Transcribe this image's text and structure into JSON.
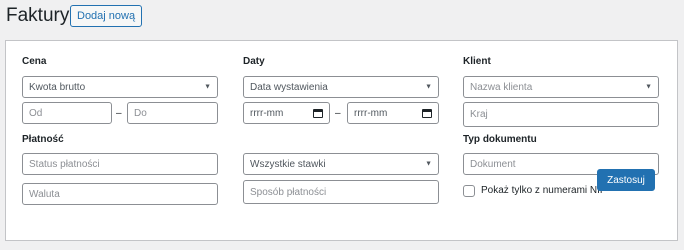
{
  "header": {
    "title": "Faktury",
    "add_new_label": "Dodaj nową"
  },
  "filters": {
    "price": {
      "label": "Cena",
      "type_select": "Kwota brutto",
      "from_placeholder": "Od",
      "to_placeholder": "Do",
      "separator": "–"
    },
    "dates": {
      "label": "Daty",
      "type_select": "Data wystawienia",
      "from_placeholder": "rrrr-mm",
      "to_placeholder": "rrrr-mm",
      "separator": "–"
    },
    "client": {
      "label": "Klient",
      "name_placeholder": "Nazwa klienta",
      "country_placeholder": "Kraj"
    },
    "payment": {
      "label": "Płatność",
      "status_placeholder": "Status płatności",
      "currency_placeholder": "Waluta"
    },
    "rates": {
      "select": "Wszystkie stawki",
      "payment_method_placeholder": "Sposób płatności"
    },
    "document": {
      "label": "Typ dokumentu",
      "placeholder": "Dokument",
      "nip_checkbox_label": "Pokaż tylko z numerami NIP"
    },
    "apply_label": "Zastosuj"
  }
}
